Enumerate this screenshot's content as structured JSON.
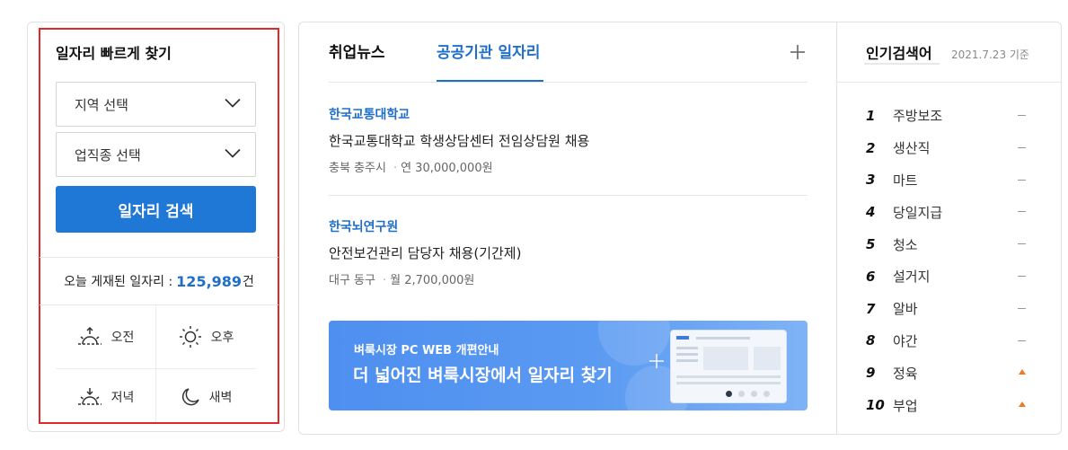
{
  "quick_search": {
    "title": "일자리 빠르게 찾기",
    "region_select": "지역 선택",
    "industry_select": "업직종 선택",
    "search_button": "일자리 검색",
    "posted_label": "오늘 게재된 일자리 :",
    "posted_count": "125,989",
    "posted_unit": "건",
    "time_slots": {
      "morning": "오전",
      "afternoon": "오후",
      "evening": "저녁",
      "dawn": "새벽"
    }
  },
  "news": {
    "tabs": {
      "news": "취업뉴스",
      "public": "공공기관 일자리"
    },
    "active_tab": "공공기관 일자리",
    "jobs": [
      {
        "org": "한국교통대학교",
        "title": "한국교통대학교 학생상담센터 전임상담원 채용",
        "location": "충북 충주시",
        "salary": "연 30,000,000원"
      },
      {
        "org": "한국뇌연구원",
        "title": "안전보건관리 담당자 채용(기간제)",
        "location": "대구 동구",
        "salary": "월 2,700,000원"
      }
    ],
    "banner": {
      "sub": "벼룩시장 PC WEB 개편안내",
      "main": "더 넓어진 벼룩시장에서 일자리 찾기",
      "active_dot": 1,
      "dot_count": 4
    }
  },
  "ranking": {
    "title": "인기검색어",
    "date": "2021.7.23 기준",
    "items": [
      {
        "rank": "1",
        "word": "주방보조",
        "trend": "flat"
      },
      {
        "rank": "2",
        "word": "생산직",
        "trend": "flat"
      },
      {
        "rank": "3",
        "word": "마트",
        "trend": "flat"
      },
      {
        "rank": "4",
        "word": "당일지급",
        "trend": "flat"
      },
      {
        "rank": "5",
        "word": "청소",
        "trend": "flat"
      },
      {
        "rank": "6",
        "word": "설거지",
        "trend": "flat"
      },
      {
        "rank": "7",
        "word": "알바",
        "trend": "flat"
      },
      {
        "rank": "8",
        "word": "야간",
        "trend": "flat"
      },
      {
        "rank": "9",
        "word": "정육",
        "trend": "up"
      },
      {
        "rank": "10",
        "word": "부업",
        "trend": "up"
      }
    ]
  },
  "colors": {
    "accent": "#1f6fc9",
    "button": "#1f77d6",
    "highlight": "#e0282a",
    "trend_up": "#f07a24"
  }
}
